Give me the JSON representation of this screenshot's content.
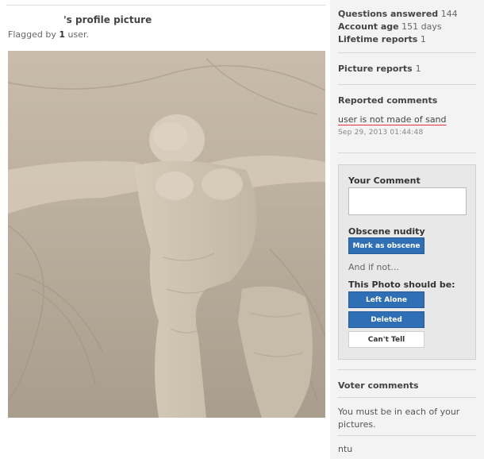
{
  "profile": {
    "title_suffix": "'s profile picture",
    "flagged_prefix": "Flagged by",
    "flagged_count": "1",
    "flagged_suffix": "user."
  },
  "stats": {
    "questions_label": "Questions answered",
    "questions_value": "144",
    "age_label": "Account age",
    "age_value": "151 days",
    "reports_label": "Lifetime reports",
    "reports_value": "1"
  },
  "picture_reports": {
    "label": "Picture reports",
    "value": "1"
  },
  "reported_comments": {
    "title": "Reported comments",
    "text": "user is not made of sand",
    "time": "Sep 29, 2013 01:44:48"
  },
  "review": {
    "comment_label": "Your Comment",
    "comment_value": "",
    "nudity_label": "Obscene nudity",
    "mark_button": "Mark as obscene",
    "and_if_not": "And if not...",
    "should_be_label": "This Photo should be:",
    "left_alone_button": "Left Alone",
    "deleted_button": "Deleted",
    "cant_tell_button": "Can't Tell"
  },
  "voter_comments": {
    "title": "Voter comments",
    "items": [
      "You must be in each of your pictures.",
      "ntu"
    ]
  },
  "colors": {
    "accent": "#2f6fb6",
    "underline": "#e0303a",
    "sidebar_bg": "#f3f3f3"
  }
}
